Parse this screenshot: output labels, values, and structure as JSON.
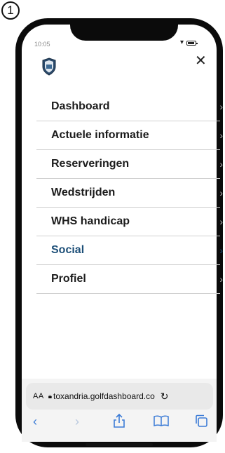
{
  "step_number": "1",
  "status_bar": {
    "time": "10:05"
  },
  "menu": {
    "items": [
      {
        "label": "Dashboard"
      },
      {
        "label": "Actuele informatie"
      },
      {
        "label": "Reserveringen"
      },
      {
        "label": "Wedstrijden"
      },
      {
        "label": "WHS handicap"
      },
      {
        "label": "Social",
        "active": true
      },
      {
        "label": "Profiel"
      }
    ]
  },
  "browser": {
    "text_size_label": "AA",
    "url": "toxandria.golfdashboard.co"
  },
  "colors": {
    "accent": "#1d4f78",
    "toolbar_blue": "#3b7bd6"
  }
}
